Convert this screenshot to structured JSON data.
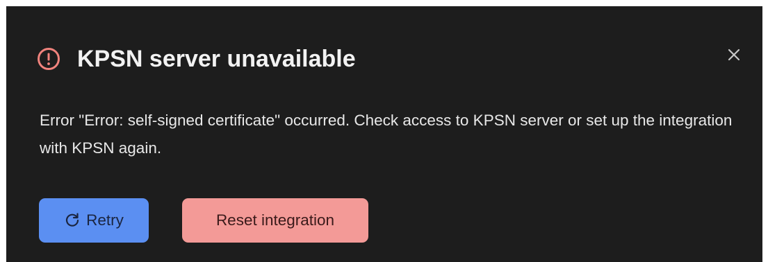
{
  "notification": {
    "title": "KPSN server unavailable",
    "message": "Error \"Error: self-signed certificate\" occurred. Check access to KPSN server or set up the integration with KPSN again.",
    "icons": {
      "alert": "alert-circle-icon",
      "close": "close-icon",
      "retry": "refresh-icon"
    },
    "colors": {
      "background": "#1d1d1d",
      "alert_icon": "#f0837d",
      "retry_button": "#5b8ff2",
      "reset_button": "#f39a97"
    }
  },
  "actions": {
    "retry_label": "Retry",
    "reset_label": "Reset integration"
  }
}
